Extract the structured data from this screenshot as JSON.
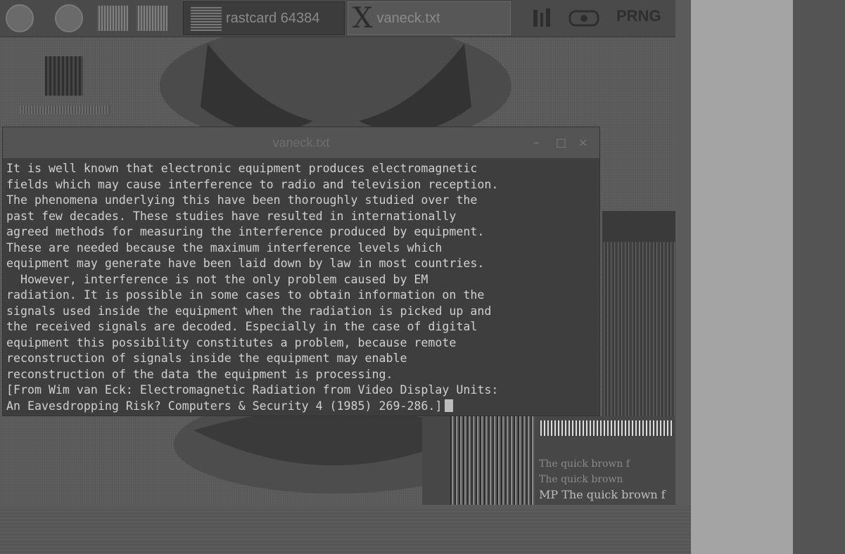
{
  "taskbar": {
    "tasks": [
      {
        "label": "rastcard 64384"
      },
      {
        "label": "vaneck.txt"
      }
    ],
    "tray_label": "PRNG"
  },
  "terminal": {
    "title": "vaneck.txt",
    "controls": {
      "minimize": "–",
      "maximize": "□",
      "close": "×"
    },
    "lines": [
      "It is well known that electronic equipment produces electromagnetic",
      "fields which may cause interference to radio and television reception.",
      "The phenomena underlying this have been thoroughly studied over the",
      "past few decades. These studies have resulted in internationally",
      "agreed methods for measuring the interference produced by equipment.",
      "These are needed because the maximum interference levels which",
      "equipment may generate have been laid down by law in most countries.",
      "  However, interference is not the only problem caused by EM",
      "radiation. It is possible in some cases to obtain information on the",
      "signals used inside the equipment when the radiation is picked up and",
      "the received signals are decoded. Especially in the case of digital",
      "equipment this possibility constitutes a problem, because remote",
      "reconstruction of signals inside the equipment may enable",
      "reconstruction of the data the equipment is processing.",
      "[From Wim van Eck: Electromagnetic Radiation from Video Display Units:",
      "An Eavesdropping Risk? Computers & Security 4 (1985) 269-286.]"
    ]
  },
  "background_window": {
    "lines": [
      "The quick brown f",
      "The quick brown",
      "MP The quick brown f"
    ]
  }
}
